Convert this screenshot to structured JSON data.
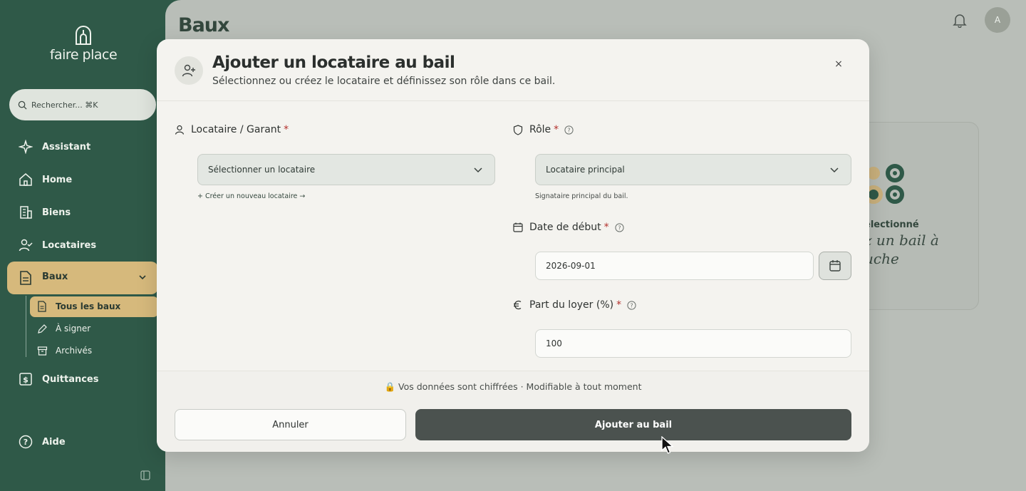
{
  "sidebar": {
    "logo_text": "faire place",
    "search_placeholder": "Rechercher... ⌘K",
    "items": [
      {
        "label": "Assistant",
        "icon": "sparkle-icon"
      },
      {
        "label": "Home",
        "icon": "home-icon"
      },
      {
        "label": "Biens",
        "icon": "building-icon"
      },
      {
        "label": "Locataires",
        "icon": "user-check-icon"
      },
      {
        "label": "Baux",
        "icon": "document-icon"
      },
      {
        "label": "Quittances",
        "icon": "dollar-receipt-icon"
      },
      {
        "label": "Aide",
        "icon": "help-circle-icon"
      }
    ],
    "sub_items": [
      {
        "label": "Tous les baux",
        "icon": "document-icon"
      },
      {
        "label": "À signer",
        "icon": "pen-icon"
      },
      {
        "label": "Archivés",
        "icon": "archive-icon"
      }
    ]
  },
  "main": {
    "title": "Baux",
    "avatar_initial": "A",
    "empty_card": {
      "line1": "électionné",
      "line2": "z un bail à",
      "line3": "uche"
    }
  },
  "modal": {
    "title": "Ajouter un locataire au bail",
    "subtitle": "Sélectionnez ou créez le locataire et définissez son rôle dans ce bail.",
    "close": "×",
    "tenant": {
      "label": "Locataire / Garant",
      "required": "*",
      "placeholder": "Sélectionner un locataire",
      "create_link": "+ Créer un nouveau locataire →"
    },
    "role": {
      "label": "Rôle",
      "required": "*",
      "value": "Locataire principal",
      "hint": "Signataire principal du bail."
    },
    "start_date": {
      "label": "Date de début",
      "required": "*",
      "value": "2026-09-01"
    },
    "rent_share": {
      "label": "Part du loyer (%)",
      "required": "*",
      "value": "100"
    },
    "security_note": "🔒 Vos données sont chiffrées · Modifiable à tout moment",
    "cancel_label": "Annuler",
    "submit_label": "Ajouter au bail"
  },
  "colors": {
    "sidebar_bg": "#2f5948",
    "accent": "#d6b97c",
    "primary_button": "#4b524f",
    "required": "#b3302c"
  }
}
